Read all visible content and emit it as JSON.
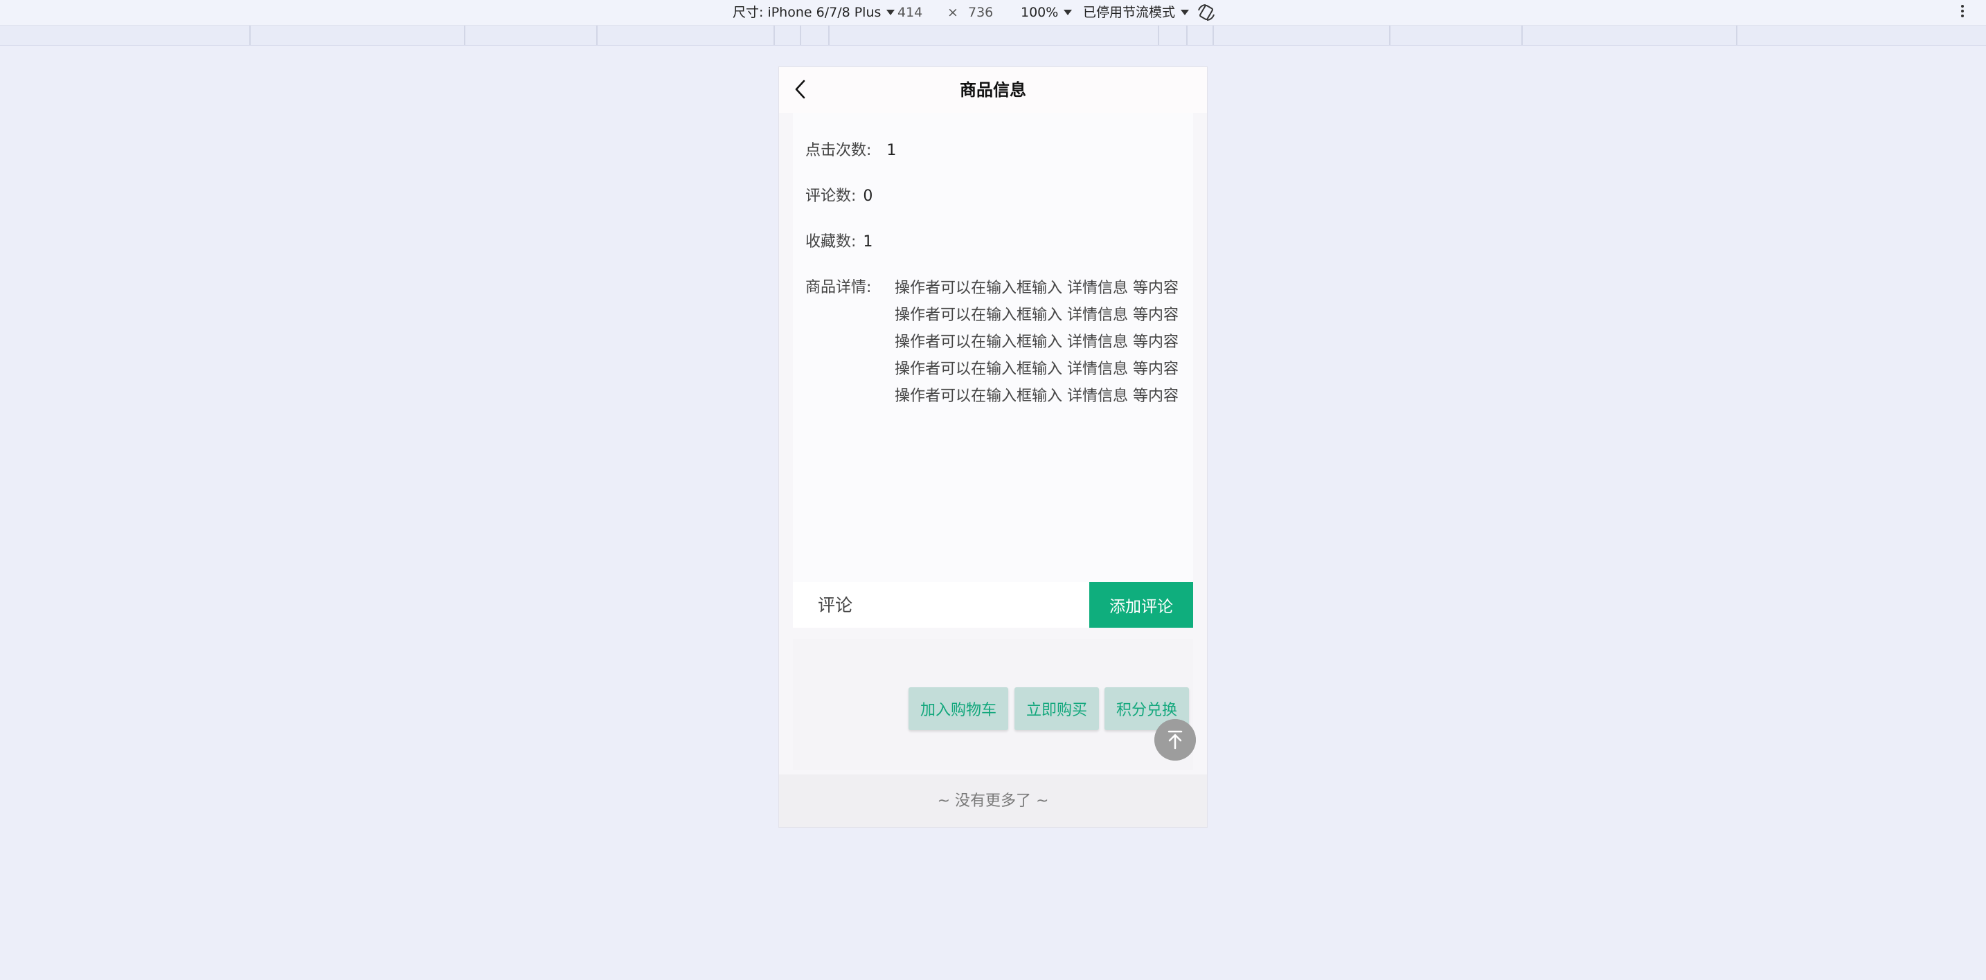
{
  "devtools": {
    "device_label": "尺寸: iPhone 6/7/8 Plus",
    "width": "414",
    "times": "×",
    "height": "736",
    "zoom": "100%",
    "throttle": "已停用节流模式"
  },
  "page": {
    "title": "商品信息",
    "stats": [
      {
        "label": "点击次数:",
        "value": "1"
      },
      {
        "label": "评论数:",
        "value": "0"
      },
      {
        "label": "收藏数:",
        "value": "1"
      }
    ],
    "details_label": "商品详情:",
    "details_lines": [
      "操作者可以在输入框输入 详情信息 等内容",
      "操作者可以在输入框输入 详情信息 等内容",
      "操作者可以在输入框输入 详情信息 等内容",
      "操作者可以在输入框输入 详情信息 等内容",
      "操作者可以在输入框输入 详情信息 等内容"
    ],
    "comment": {
      "placeholder": "评论",
      "button": "添加评论"
    },
    "actions": {
      "add_cart": "加入购物车",
      "buy_now": "立即购买",
      "points": "积分兑换"
    },
    "footer": "~ 没有更多了 ~"
  },
  "colors": {
    "accent": "#0fae7d",
    "action_bg": "#c3ddd9",
    "scroll_top": "#9d9d9d"
  },
  "icons": [
    "chevron-left-icon",
    "rotate-icon",
    "more-vertical-icon",
    "arrow-up-icon",
    "caret-down-icon"
  ]
}
